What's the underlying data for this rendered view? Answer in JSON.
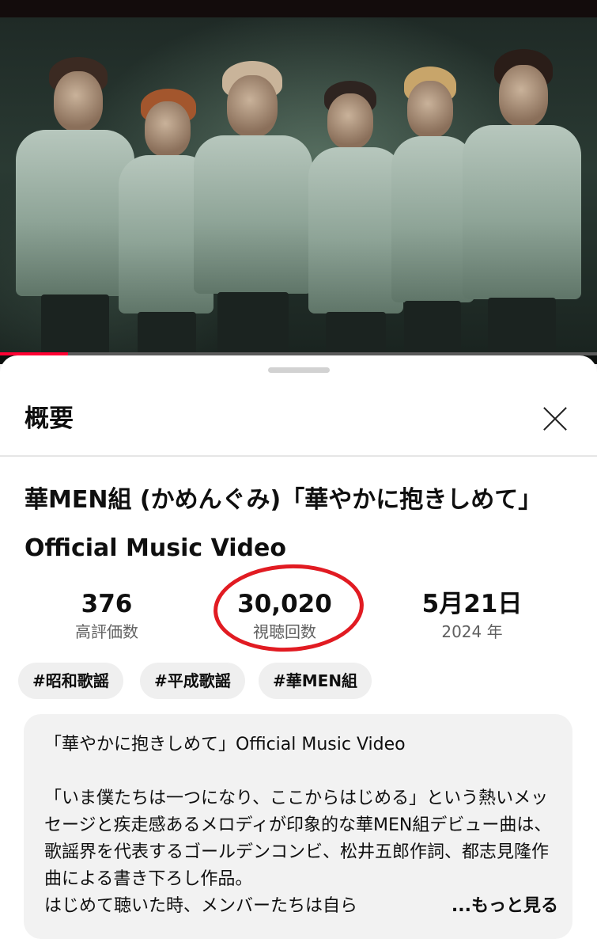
{
  "video": {
    "progress_fraction": 0.114
  },
  "sheet": {
    "title": "概要",
    "close_icon": "close-icon"
  },
  "video_info": {
    "title": "華MEN組 (かめんぐみ)「華やかに抱きしめて」Official Music Video",
    "stats": [
      {
        "value": "376",
        "label": "高評価数"
      },
      {
        "value": "30,020",
        "label": "視聴回数"
      },
      {
        "value": "5月21日",
        "label": "2024 年"
      }
    ],
    "annotation_color": "#e11b22"
  },
  "tags": [
    "#昭和歌謡",
    "#平成歌謡",
    "#華MEN組"
  ],
  "description": {
    "line1": "「華やかに抱きしめて」Official Music Video",
    "para": "「いま僕たちは一つになり、ここからはじめる」という熱いメッセージと疾走感あるメロディが印象的な華MEN組デビュー曲は、歌謡界を代表するゴールデンコンビ、松井五郎作詞、都志見隆作曲による書き下ろし作品。",
    "last_line": "はじめて聴いた時、メンバーたちは自ら",
    "more_label": "...もっと見る"
  },
  "colors": {
    "progress": "#ff0033",
    "sheet_bg": "#ffffff",
    "chip_bg": "#efefef"
  }
}
